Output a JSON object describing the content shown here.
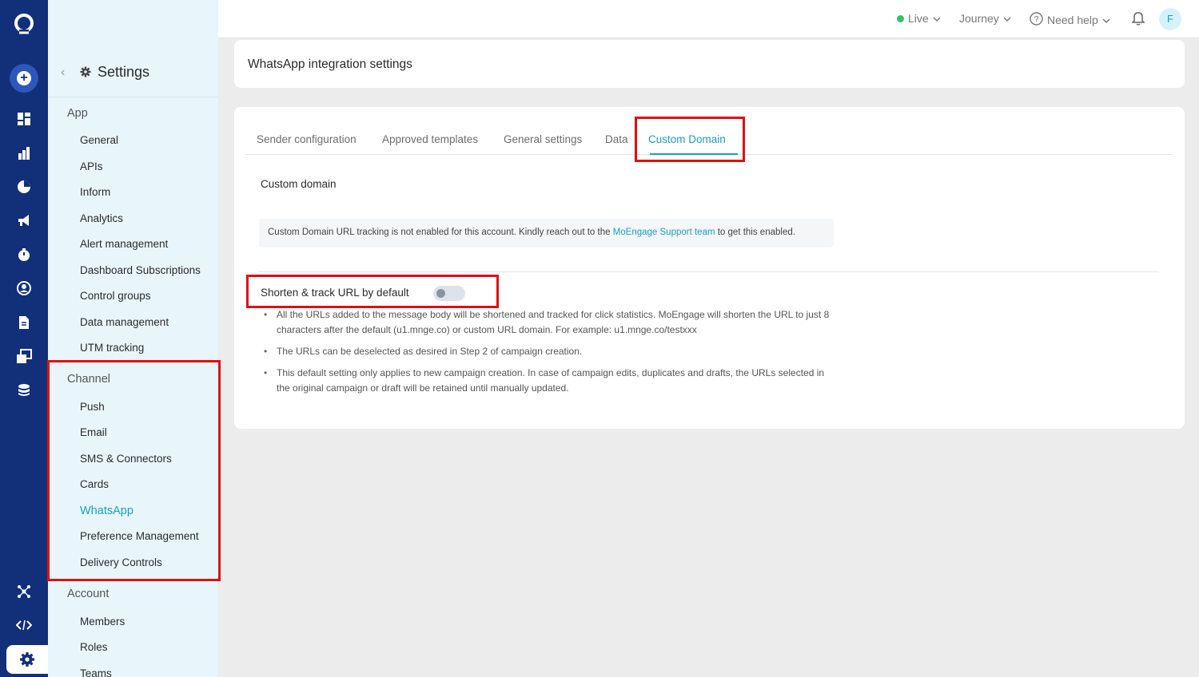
{
  "sidebar": {
    "title": "Settings",
    "sections": {
      "app": {
        "label": "App",
        "items": [
          "General",
          "APIs",
          "Inform",
          "Analytics",
          "Alert management",
          "Dashboard Subscriptions",
          "Control groups",
          "Data management",
          "UTM tracking"
        ]
      },
      "channel": {
        "label": "Channel",
        "items": [
          "Push",
          "Email",
          "SMS & Connectors",
          "Cards",
          "WhatsApp",
          "Preference Management",
          "Delivery Controls"
        ]
      },
      "account": {
        "label": "Account",
        "items": [
          "Members",
          "Roles",
          "Teams"
        ]
      }
    },
    "active_item": "WhatsApp"
  },
  "topbar": {
    "live": "Live",
    "journey": "Journey",
    "help": "Need help",
    "avatar": "F"
  },
  "page": {
    "title": "WhatsApp integration settings",
    "tabs": [
      "Sender configuration",
      "Approved templates",
      "General settings",
      "Data",
      "Custom Domain"
    ],
    "active_tab": "Custom Domain",
    "section_title": "Custom domain",
    "notice": {
      "prefix": "Custom Domain URL tracking is not enabled for this account. Kindly reach out to the ",
      "link": "MoEngage Support team",
      "suffix": " to get this enabled."
    },
    "shorten_label": "Shorten & track URL by default",
    "shorten_enabled": false,
    "bullets": [
      "All the URLs added to the message body will be shortened and tracked for click statistics. MoEngage will shorten the URL to just 8 characters after the default (u1.mnge.co) or custom URL domain. For example: u1.mnge.co/testxxx",
      "The URLs can be deselected as desired in Step 2 of campaign creation.",
      "This default setting only applies to new campaign creation. In case of campaign edits, duplicates and drafts, the URLs selected in the original campaign or draft will be retained until manually updated."
    ]
  },
  "colors": {
    "rail": "#12307a",
    "accent": "#1a9ec0",
    "highlight": "#e01010",
    "live": "#33c26a"
  },
  "icons": {
    "rail": [
      "moengage-logo-icon",
      "create-plus-icon",
      "dashboard-icon",
      "analytics-bar-icon",
      "segment-pie-icon",
      "campaign-megaphone-icon",
      "flows-stopwatch-icon",
      "user-profile-icon",
      "document-icon",
      "content-gallery-icon",
      "data-database-icon",
      "apps-network-icon",
      "code-icon",
      "settings-gear-icon"
    ]
  }
}
